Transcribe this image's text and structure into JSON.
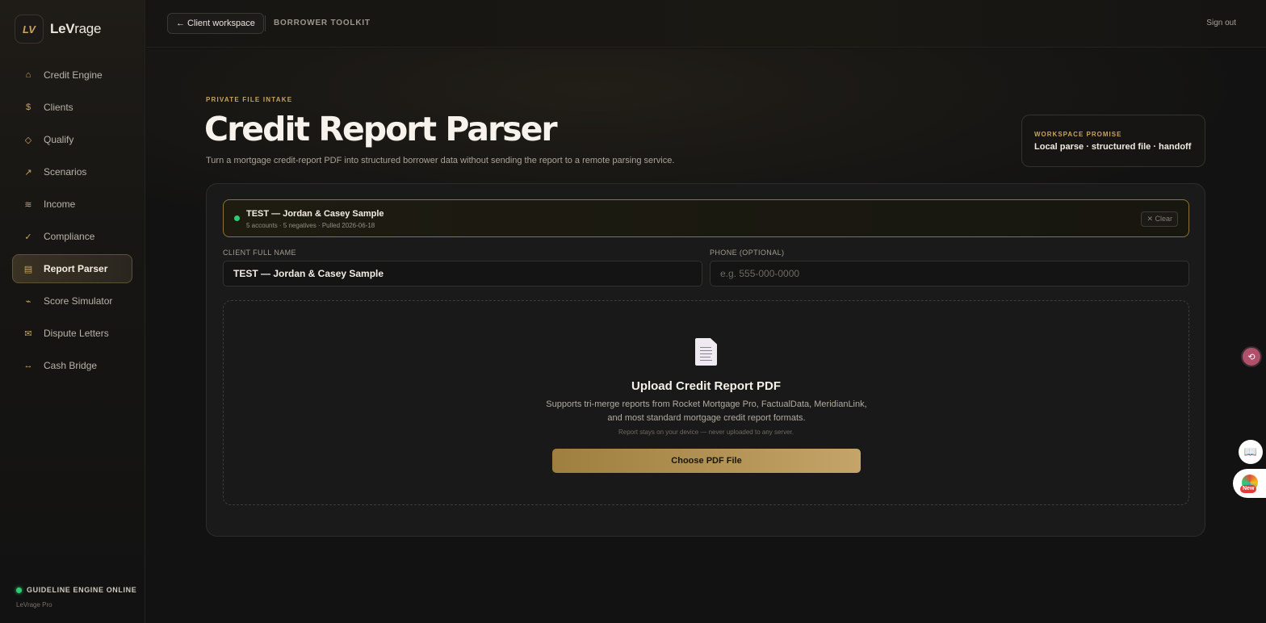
{
  "brand": {
    "logo_mark": "LV",
    "name_bold": "LeV",
    "name_rest": "rage"
  },
  "sidebar": {
    "items": [
      {
        "label": "Credit Engine",
        "icon": "home-icon",
        "glyph": "⌂"
      },
      {
        "label": "Clients",
        "icon": "dollar-coin-icon",
        "glyph": "$"
      },
      {
        "label": "Qualify",
        "icon": "diamond-icon",
        "glyph": "◇"
      },
      {
        "label": "Scenarios",
        "icon": "trend-arrow-icon",
        "glyph": "↗"
      },
      {
        "label": "Income",
        "icon": "waves-icon",
        "glyph": "≋"
      },
      {
        "label": "Compliance",
        "icon": "checkmark-icon",
        "glyph": "✓"
      },
      {
        "label": "Report Parser",
        "icon": "document-lines-icon",
        "glyph": "▤",
        "active": true
      },
      {
        "label": "Score Simulator",
        "icon": "lightning-icon",
        "glyph": "⌁"
      },
      {
        "label": "Dispute Letters",
        "icon": "envelope-icon",
        "glyph": "✉"
      },
      {
        "label": "Cash Bridge",
        "icon": "double-arrow-icon",
        "glyph": "↔"
      }
    ],
    "status": "GUIDELINE ENGINE ONLINE",
    "sub_brand": "LeVrage Pro"
  },
  "topbar": {
    "back_label": "← Client workspace",
    "section_label": "BORROWER TOOLKIT",
    "signout_label": "Sign out"
  },
  "header": {
    "eyebrow": "PRIVATE FILE INTAKE",
    "title": "Credit Report Parser",
    "description": "Turn a mortgage credit-report PDF into structured borrower data without sending the report to a remote parsing service."
  },
  "promise": {
    "eyebrow": "WORKSPACE PROMISE",
    "text": "Local parse · structured file · handoff"
  },
  "sample": {
    "title": "TEST — Jordan & Casey Sample",
    "meta": "5 accounts · 5 negatives · Pulled 2026-06-18",
    "clear_label": "✕ Clear"
  },
  "form": {
    "name_label": "CLIENT FULL NAME",
    "name_value": "TEST — Jordan & Casey Sample",
    "phone_label": "PHONE (OPTIONAL)",
    "phone_placeholder": "e.g. 555-000-0000",
    "phone_value": ""
  },
  "upload": {
    "title": "Upload Credit Report PDF",
    "description": "Supports tri-merge reports from Rocket Mortgage Pro, FactualData, MeridianLink, and most standard mortgage credit report formats.",
    "note": "Report stays on your device — never uploaded to any server.",
    "button_label": "Choose PDF File"
  },
  "floating": {
    "translate_glyph": "⟲",
    "book_glyph": "📖",
    "new_badge": "New"
  },
  "colors": {
    "accent": "#c9a35f",
    "status_green": "#2ecc71",
    "background": "#121212"
  }
}
